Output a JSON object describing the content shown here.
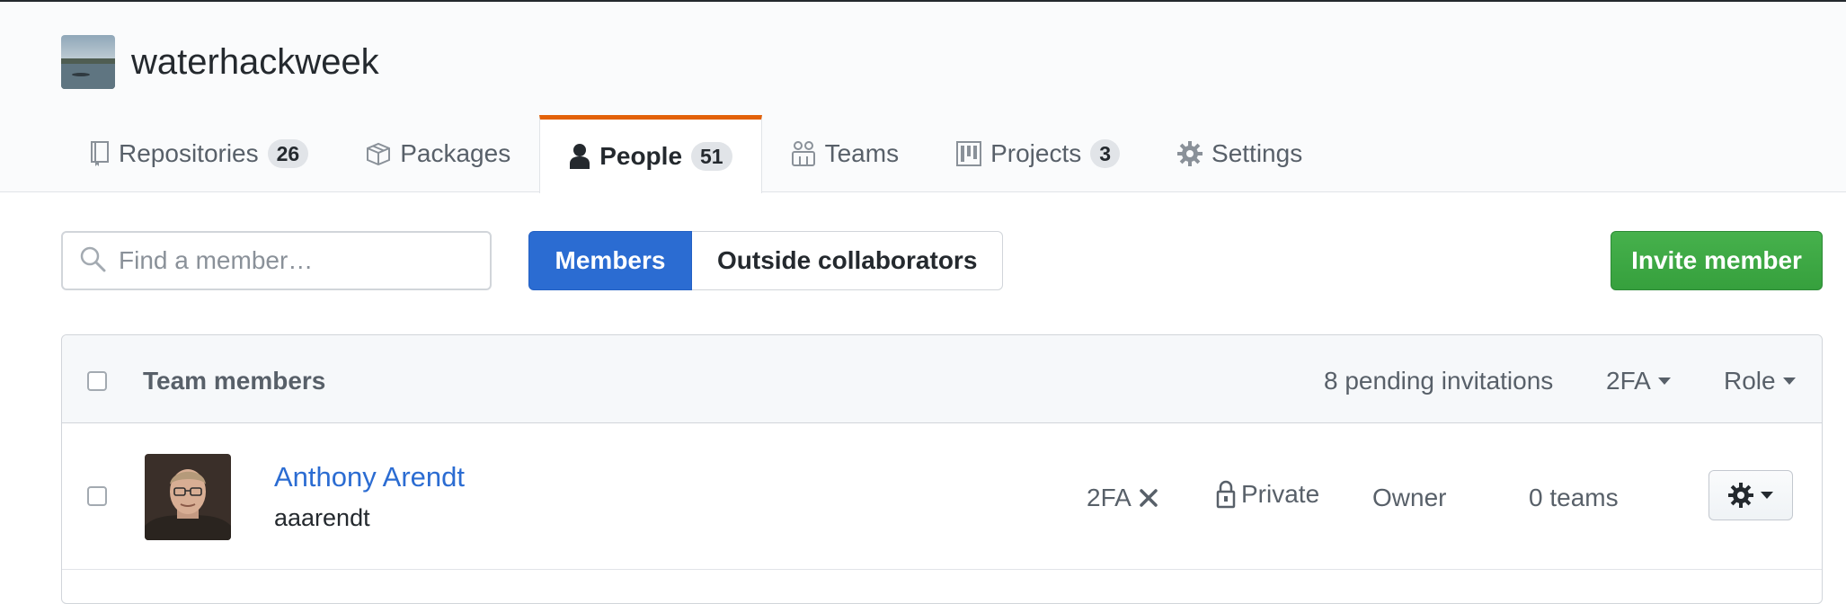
{
  "org": {
    "name": "waterhackweek"
  },
  "tabs": [
    {
      "label": "Repositories",
      "count": "26",
      "icon": "repo-icon"
    },
    {
      "label": "Packages",
      "count": "",
      "icon": "package-icon"
    },
    {
      "label": "People",
      "count": "51",
      "icon": "person-icon",
      "selected": true
    },
    {
      "label": "Teams",
      "count": "",
      "icon": "people-icon"
    },
    {
      "label": "Projects",
      "count": "3",
      "icon": "project-icon"
    },
    {
      "label": "Settings",
      "count": "",
      "icon": "gear-icon"
    }
  ],
  "search": {
    "placeholder": "Find a member…",
    "value": ""
  },
  "segments": {
    "members": "Members",
    "outside": "Outside collaborators"
  },
  "invite_label": "Invite member",
  "table": {
    "header": {
      "title": "Team members",
      "pending": "8 pending invitations",
      "twofa": "2FA",
      "role": "Role"
    },
    "rows": [
      {
        "name": "Anthony Arendt",
        "login": "aaarendt",
        "twofa": "2FA",
        "privacy": "Private",
        "role": "Owner",
        "teams": "0 teams"
      }
    ]
  },
  "colors": {
    "accent": "#e36209",
    "link": "#2b6cd2",
    "primary": "#2b6cd2",
    "invite": "#3ea846"
  }
}
